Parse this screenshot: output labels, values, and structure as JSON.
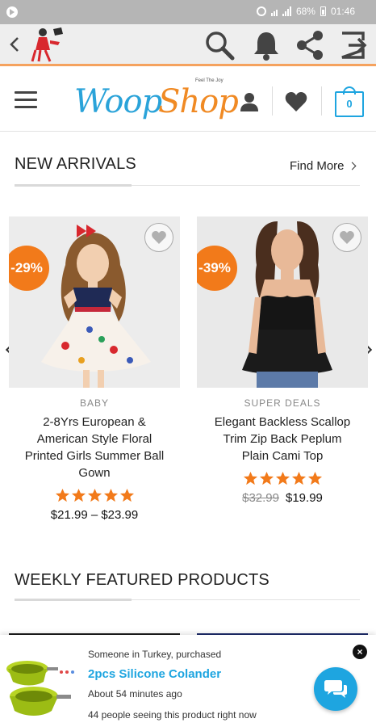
{
  "status_bar": {
    "battery": "68%",
    "time": "01:46"
  },
  "header": {
    "brand_part1": "Woop",
    "brand_part2": "Shop",
    "tagline": "Feel The Joy",
    "cart_count": "0"
  },
  "new_arrivals": {
    "title": "NEW ARRIVALS",
    "find_more": "Find More",
    "products": [
      {
        "badge": "-29%",
        "category": "BABY",
        "name": "2-8Yrs European & American Style Floral Printed Girls Summer Ball Gown",
        "rating": 5,
        "old_price": "",
        "price": "$21.99 – $23.99"
      },
      {
        "badge": "-39%",
        "category": "SUPER DEALS",
        "name": "Elegant Backless Scallop Trim Zip Back Peplum Plain Cami Top",
        "rating": 5,
        "old_price": "$32.99",
        "price": "$19.99"
      }
    ]
  },
  "weekly": {
    "title": "WEEKLY FEATURED PRODUCTS"
  },
  "popup": {
    "line1": "Someone in Turkey, purchased",
    "product": "2pcs Silicone Colander",
    "time_ago": "About 54 minutes ago",
    "viewers": "44 people seeing this product right now",
    "close": "×"
  },
  "colors": {
    "accent_orange": "#f27a1a",
    "brand_blue": "#1ea5e0",
    "brand_orange": "#f08a24"
  }
}
